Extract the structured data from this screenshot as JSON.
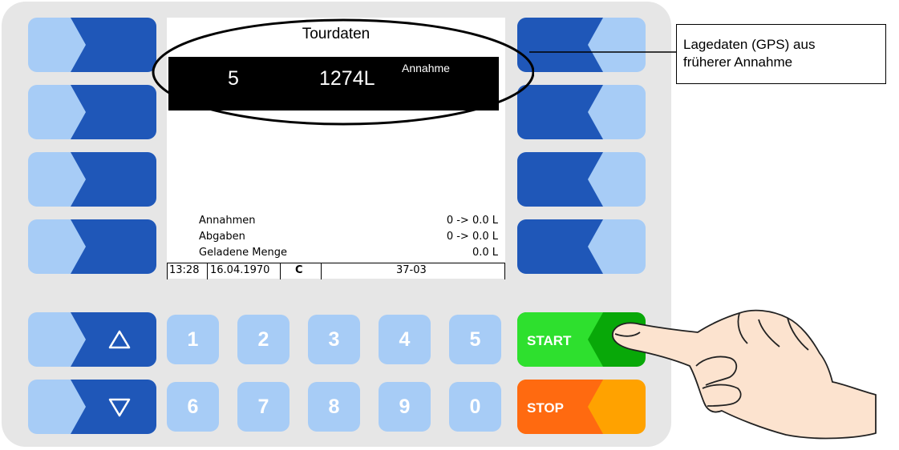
{
  "screen": {
    "title": "Tourdaten",
    "entry": {
      "number": "5",
      "volume": "1274L",
      "type": "Annahme"
    },
    "summary": [
      {
        "label": "Annahmen",
        "value": "0 -> 0.0 L"
      },
      {
        "label": "Abgaben",
        "value": "0 -> 0.0 L"
      },
      {
        "label": "Geladene Menge",
        "value": "0.0 L"
      }
    ],
    "status": {
      "time": "13:28",
      "date": "16.04.1970",
      "mode": "C",
      "code": "37-03"
    }
  },
  "callout": {
    "line1": "Lagedaten (GPS) aus",
    "line2": "früherer Annahme"
  },
  "keypad": {
    "digits_top": [
      "1",
      "2",
      "3",
      "4",
      "5"
    ],
    "digits_bottom": [
      "6",
      "7",
      "8",
      "9",
      "0"
    ],
    "up_icon": "up-triangle-icon",
    "down_icon": "down-triangle-icon"
  },
  "start_label": "START",
  "stop_label": "STOP",
  "colors": {
    "key_light": "#a7ccf6",
    "key_dark": "#1f57b8",
    "start_light": "#2ee02e",
    "start_dark": "#08a808",
    "stop_light": "#ff6a10",
    "stop_dark": "#ffa200"
  }
}
